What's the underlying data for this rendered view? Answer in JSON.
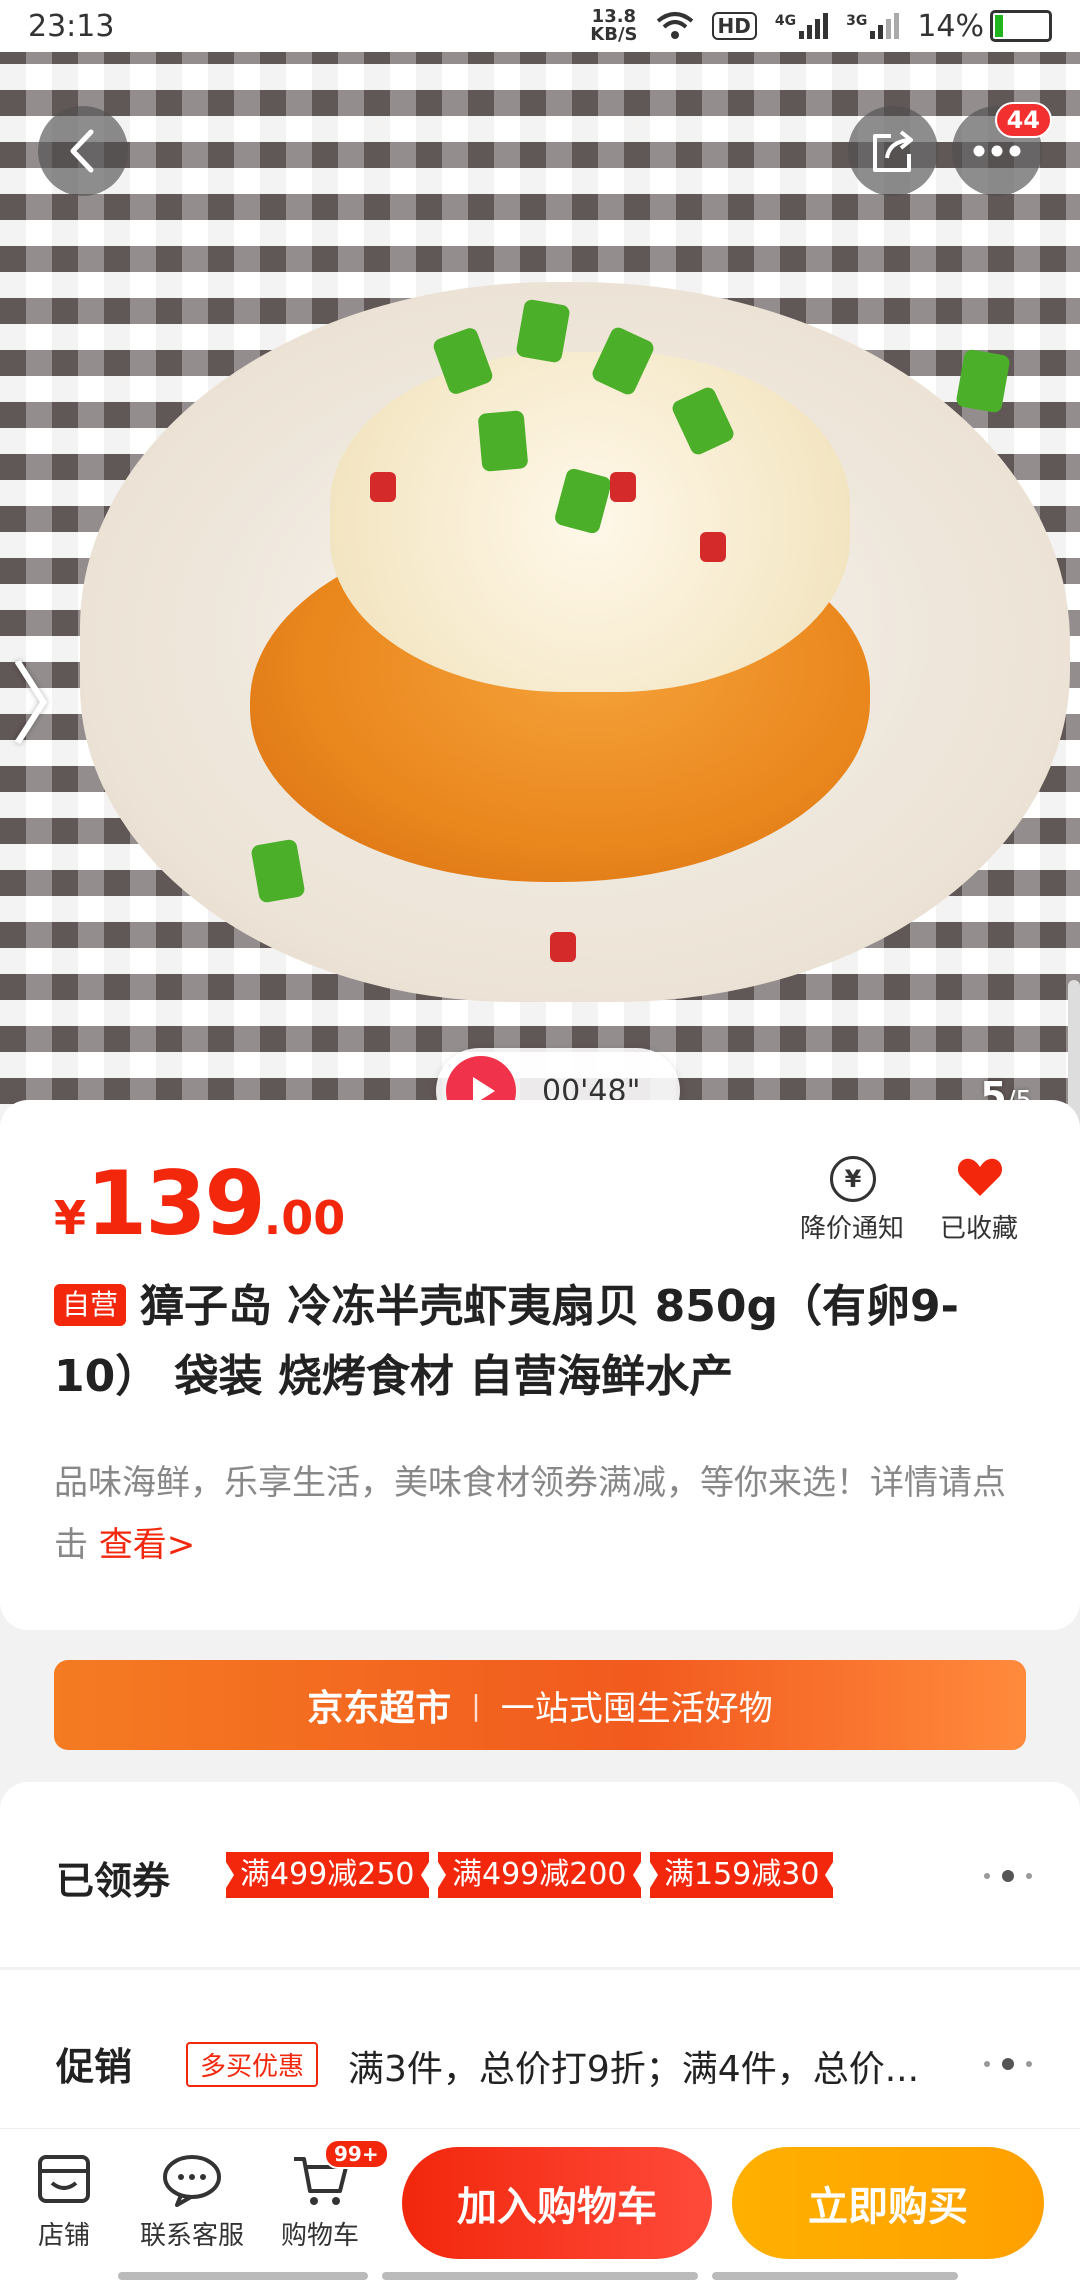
{
  "status_bar": {
    "time": "23:13",
    "network_speed_top": "13.8",
    "network_speed_unit": "KB/S",
    "hd_label": "HD",
    "sim1": "4G",
    "sim2": "3G",
    "battery": "14%"
  },
  "header": {
    "more_badge": "44"
  },
  "gallery": {
    "video_duration": "00'48\"",
    "page_current": "5",
    "page_total": "/5"
  },
  "product": {
    "currency": "¥",
    "price_int": "139",
    "price_dec": ".00",
    "price_alert_label": "降价通知",
    "favorite_label": "已收藏",
    "self_tag": "自营",
    "title": "獐子岛 冷冻半壳虾夷扇贝 850g（有卵9-10） 袋装 烧烤食材 自营海鲜水产",
    "description": "品味海鲜，乐享生活，美味食材领券满减，等你来选！详情请点击",
    "description_link": "查看>"
  },
  "banner": {
    "brand": "京东超市",
    "separator": "|",
    "slogan": "一站式囤生活好物"
  },
  "coupons": {
    "label": "已领券",
    "items": [
      "满499减250",
      "满499减200",
      "满159减30"
    ]
  },
  "promotion": {
    "label": "促销",
    "tag": "多买优惠",
    "text": "满3件，总价打9折；满4件，总价..."
  },
  "bottom_bar": {
    "store_label": "店铺",
    "service_label": "联系客服",
    "cart_label": "购物车",
    "cart_badge": "99+",
    "add_to_cart": "加入购物车",
    "buy_now": "立即购买"
  },
  "colors": {
    "accent_red": "#f2270c",
    "buy_orange": "#ffa800",
    "banner_orange": "#f25a1e"
  }
}
